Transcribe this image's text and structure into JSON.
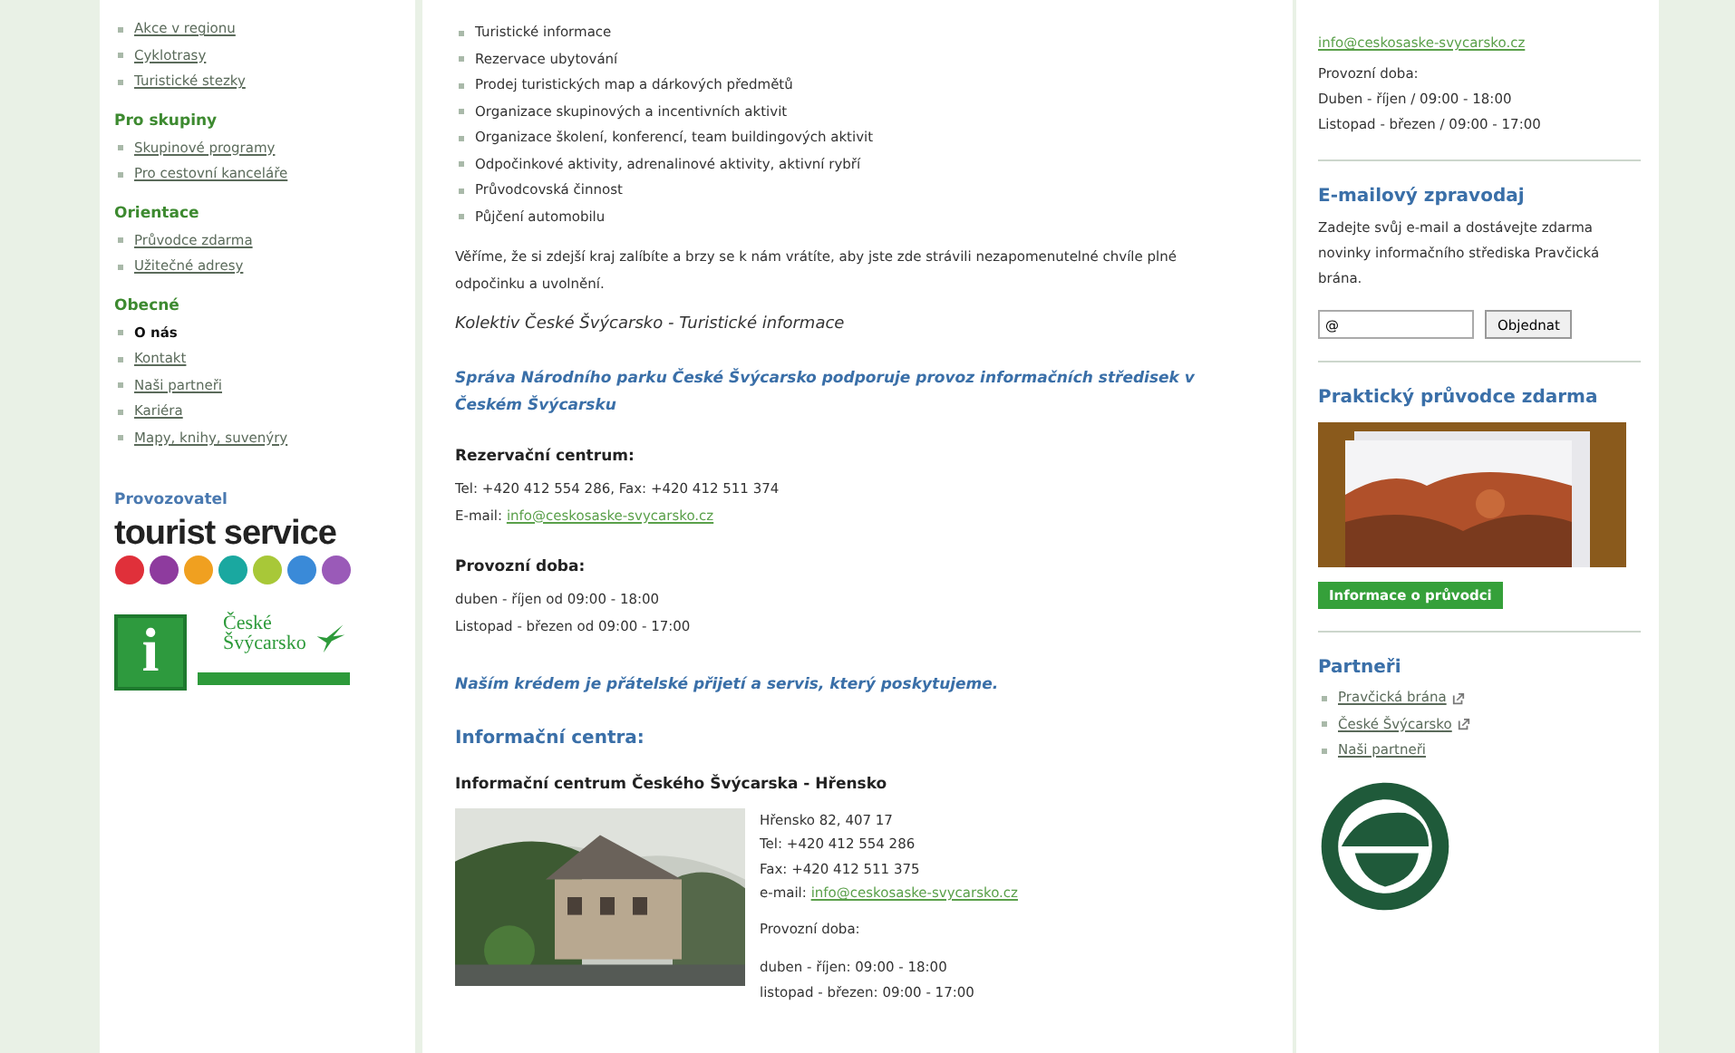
{
  "left_nav": {
    "sections": [
      {
        "items": [
          {
            "label": "Akce v regionu",
            "selected": false
          },
          {
            "label": "Cyklotrasy",
            "selected": false
          },
          {
            "label": "Turistické stezky",
            "selected": false
          }
        ]
      },
      {
        "heading": "Pro skupiny",
        "items": [
          {
            "label": "Skupinové programy",
            "selected": false
          },
          {
            "label": "Pro cestovní kanceláře",
            "selected": false
          }
        ]
      },
      {
        "heading": "Orientace",
        "items": [
          {
            "label": "Průvodce zdarma",
            "selected": false
          },
          {
            "label": "Užitečné adresy",
            "selected": false
          }
        ]
      },
      {
        "heading": "Obecné",
        "items": [
          {
            "label": "O nás",
            "selected": true
          },
          {
            "label": "Kontakt",
            "selected": false
          },
          {
            "label": "Naši partneři",
            "selected": false
          },
          {
            "label": "Kariéra",
            "selected": false
          },
          {
            "label": "Mapy, knihy, suvenýry",
            "selected": false
          }
        ]
      }
    ],
    "operator_heading": "Provozovatel",
    "operator_logo": {
      "word": "tourist service"
    },
    "region_logo": {
      "mark": "i",
      "name_line1": "České",
      "name_line2": "Švýcarsko"
    }
  },
  "main": {
    "services": [
      "Turistické informace",
      "Rezervace ubytování",
      "Prodej turistických map a dárkových předmětů",
      "Organizace skupinových a incentivních aktivit",
      "Organizace školení, konferencí, team buildingových aktivit",
      "Odpočinkové aktivity, adrenalinové aktivity, aktivní rybří",
      "Průvodcovská činnost",
      "Půjčení automobilu"
    ],
    "closing": "Věříme, že si zdejší kraj zalíbíte a brzy se k nám vrátíte, aby jste zde strávili nezapomenutelné chvíle plné odpočinku a uvolnění.",
    "signature": "Kolektiv České Švýcarsko - Turistické informace",
    "support_note": "Správa Národního parku České Švýcarsko podporuje provoz informačních středisek v Českém Švýcarsku",
    "reservation": {
      "heading": "Rezervační centrum:",
      "phone_line": "Tel: +420 412 554 286, Fax: +420 412 511 374",
      "email_label": "E-mail:",
      "email": "info@ceskosaske-svycarsko.cz"
    },
    "hours": {
      "heading": "Provozní doba:",
      "lines": [
        "duben - říjen od 09:00 - 18:00",
        "Listopad - březen od 09:00 - 17:00"
      ]
    },
    "motto": "Naším krédem je přátelské přijetí a servis, který poskytujeme.",
    "centers_heading": "Informační centra:",
    "center": {
      "name": "Informační centrum Českého Švýcarska - Hřensko",
      "lines": [
        "Hřensko 82, 407 17",
        "Tel: +420 412 554 286",
        "Fax: +420 412 511 375"
      ],
      "email_label": "e-mail:",
      "email": "info@ceskosaske-svycarsko.cz",
      "hours_heading": "Provozní doba:",
      "hours": [
        "duben - říjen: 09:00 - 18:00",
        "listopad - březen: 09:00 - 17:00"
      ]
    }
  },
  "right": {
    "email": "info@ceskosaske-svycarsko.cz",
    "hours_heading": "Provozní doba:",
    "hours": [
      "Duben - říjen / 09:00 - 18:00",
      "Listopad - březen / 09:00 - 17:00"
    ],
    "newsletter": {
      "heading": "E-mailový zpravodaj",
      "text": "Zadejte svůj e-mail a dostávejte zdarma novinky informačního střediska Pravčická brána.",
      "value": "@",
      "button": "Objednat"
    },
    "guide": {
      "heading": "Praktický průvodce zdarma",
      "button": "Informace o průvodci"
    },
    "partners": {
      "heading": "Partneři",
      "links": [
        "Pravčická brána",
        "České Švýcarsko",
        "Naši partneři"
      ]
    }
  }
}
